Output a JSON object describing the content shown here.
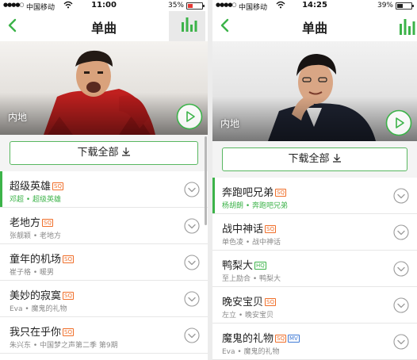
{
  "colors": {
    "accent": "#3cb349",
    "sq_badge": "#f06f2a",
    "hq_badge": "#3cb349",
    "mv_badge": "#3f7ad6"
  },
  "icons": {
    "back": "chevron-left-icon",
    "equalizer": "equalizer-icon",
    "play": "play-circle-icon",
    "download": "download-arrow-icon",
    "more": "chevron-down-circle-icon"
  },
  "screens": [
    {
      "status": {
        "signal": "●●●●○",
        "carrier": "中国移动",
        "time": "11:00",
        "battery": "35%",
        "battery_level": 0.35
      },
      "nav": {
        "title": "单曲"
      },
      "banner": {
        "region": "内地"
      },
      "download_all": "下载全部",
      "songs": [
        {
          "title": "超级英雄",
          "badges": [
            "SQ"
          ],
          "artist": "邓超",
          "album": "超级英雄",
          "sub": "邓超 • 超级英雄",
          "active": true
        },
        {
          "title": "老地方",
          "badges": [
            "SQ"
          ],
          "artist": "张靓颖",
          "album": "老地方",
          "sub": "张靓颖 • 老地方",
          "active": false
        },
        {
          "title": "童年的机场",
          "badges": [
            "SQ"
          ],
          "artist": "崔子格",
          "album": "暖男",
          "sub": "崔子格 • 暖男",
          "active": false
        },
        {
          "title": "美妙的寂寞",
          "badges": [
            "SQ"
          ],
          "artist": "Eva",
          "album": "魔鬼的礼物",
          "sub": "Eva • 魔鬼的礼物",
          "active": false
        },
        {
          "title": "我只在乎你",
          "badges": [
            "SQ"
          ],
          "artist": "朱兴东",
          "album": "中国梦之声第二季 第9期",
          "sub": "朱兴东 • 中国梦之声第二季 第9期",
          "active": false
        }
      ]
    },
    {
      "status": {
        "signal": "●●●●○",
        "carrier": "中国移动",
        "time": "14:25",
        "battery": "39%",
        "battery_level": 0.39
      },
      "nav": {
        "title": "单曲"
      },
      "banner": {
        "region": "内地"
      },
      "download_all": "下载全部",
      "songs": [
        {
          "title": "奔跑吧兄弟",
          "badges": [
            "SQ"
          ],
          "artist": "杨胡朗",
          "album": "奔跑吧兄弟",
          "sub": "杨胡朗 • 奔跑吧兄弟",
          "active": true
        },
        {
          "title": "战中神话",
          "badges": [
            "SQ"
          ],
          "artist": "单色凌",
          "album": "战中神话",
          "sub": "单色凌 • 战中神话",
          "active": false
        },
        {
          "title": "鸭梨大",
          "badges": [
            "HQ"
          ],
          "artist": "至上励合",
          "album": "鸭梨大",
          "sub": "至上励合 • 鸭梨大",
          "active": false
        },
        {
          "title": "晚安宝贝",
          "badges": [
            "SQ"
          ],
          "artist": "左立",
          "album": "晚安宝贝",
          "sub": "左立 • 晚安宝贝",
          "active": false
        },
        {
          "title": "魔鬼的礼物",
          "badges": [
            "SQ",
            "MV"
          ],
          "artist": "Eva",
          "album": "魔鬼的礼物",
          "sub": "Eva • 魔鬼的礼物",
          "active": false
        }
      ]
    }
  ]
}
